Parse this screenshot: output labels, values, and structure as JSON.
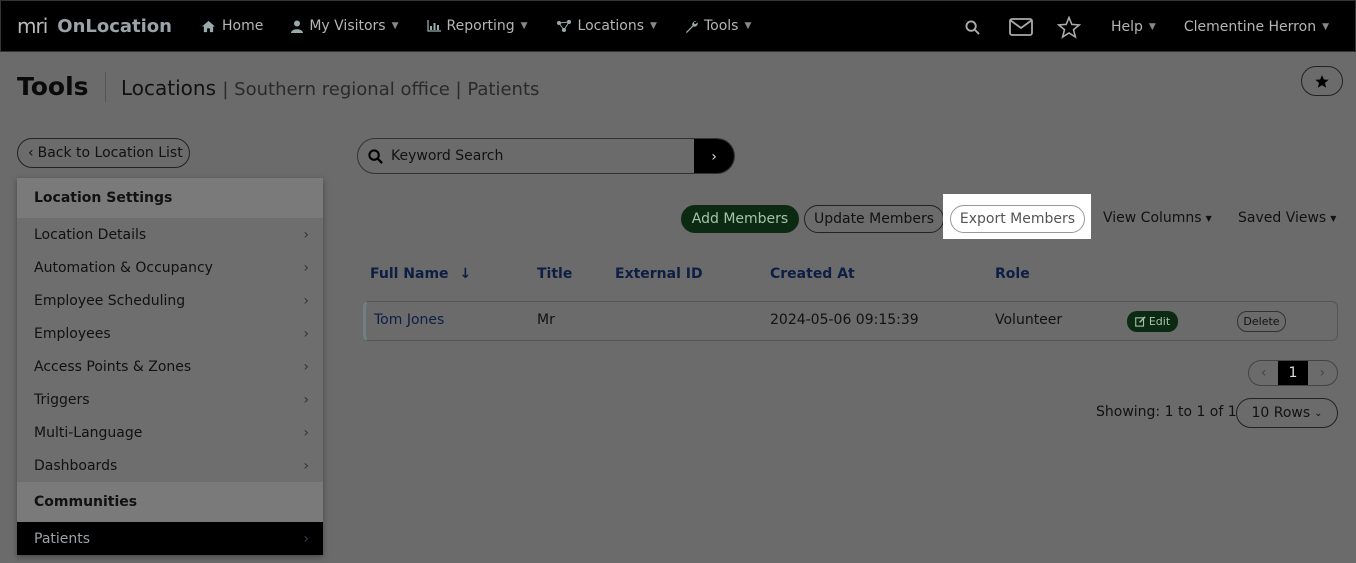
{
  "brand": {
    "logo": "mri",
    "name": "OnLocation"
  },
  "nav": {
    "items": [
      {
        "label": "Home",
        "icon": "home-icon"
      },
      {
        "label": "My Visitors",
        "icon": "user-icon"
      },
      {
        "label": "Reporting",
        "icon": "chart-icon"
      },
      {
        "label": "Locations",
        "icon": "network-icon"
      },
      {
        "label": "Tools",
        "icon": "wrench-icon"
      }
    ],
    "help": "Help",
    "user": "Clementine Herron"
  },
  "header": {
    "title": "Tools",
    "crumb_main": "Locations",
    "crumb_sub": "| Southern regional office | Patients"
  },
  "sidebar": {
    "back": "Back to Location List",
    "settings_title": "Location Settings",
    "items": [
      "Location Details",
      "Automation & Occupancy",
      "Employee Scheduling",
      "Employees",
      "Access Points & Zones",
      "Triggers",
      "Multi-Language",
      "Dashboards"
    ],
    "communities_title": "Communities",
    "active_item": "Patients"
  },
  "search": {
    "placeholder": "Keyword Search"
  },
  "toolbar": {
    "add": "Add Members",
    "update": "Update Members",
    "export": "Export Members",
    "view_columns": "View Columns",
    "saved_views": "Saved Views"
  },
  "table": {
    "columns": [
      "Full Name",
      "Title",
      "External ID",
      "Created At",
      "Role"
    ],
    "sort_indicator": "↓",
    "rows": [
      {
        "full_name": "Tom Jones",
        "title": "Mr",
        "external_id": "",
        "created_at": "2024-05-06 09:15:39",
        "role": "Volunteer",
        "edit": "Edit",
        "delete": "Delete"
      }
    ]
  },
  "pagination": {
    "current": "1",
    "showing": "Showing: 1 to 1 of 1",
    "rows": "10 Rows"
  }
}
